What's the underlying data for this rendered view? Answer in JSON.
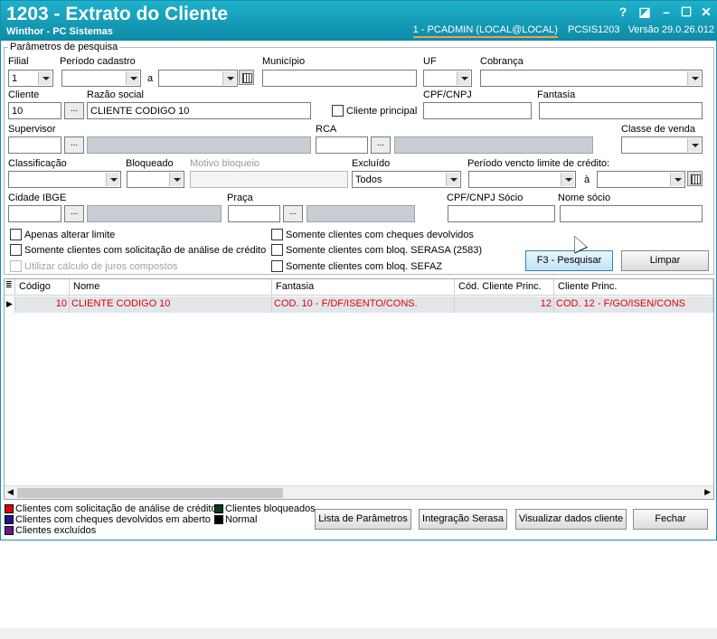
{
  "window": {
    "title": "1203 - Extrato do Cliente",
    "subtitle": "Winthor - PC Sistemas",
    "user": "1 - PCADMIN (LOCAL@LOCAL)",
    "routine": "PCSIS1203",
    "version": "Versão  29.0.26.012"
  },
  "params": {
    "legend": "Parâmetros de pesquisa",
    "filial_label": "Filial",
    "filial_value": "1",
    "periodo_cadastro_label": "Período cadastro",
    "a_label": "a",
    "municipio_label": "Município",
    "uf_label": "UF",
    "cobranca_label": "Cobrança",
    "cliente_label": "Cliente",
    "cliente_value": "10",
    "razao_social_label": "Razão social",
    "razao_social_value": "CLIENTE CODIGO 10",
    "cliente_principal_label": "Cliente principal",
    "cpf_cnpj_label": "CPF/CNPJ",
    "fantasia_label": "Fantasia",
    "supervisor_label": "Supervisor",
    "rca_label": "RCA",
    "classe_venda_label": "Classe de venda",
    "classificacao_label": "Classificação",
    "bloqueado_label": "Bloqueado",
    "motivo_bloqueio_label": "Motivo bloqueio",
    "excluido_label": "Excluído",
    "excluido_value": "Todos",
    "periodo_vencto_label": "Período vencto limite de crédito:",
    "a2_label": "à",
    "cidade_ibge_label": "Cidade IBGE",
    "praca_label": "Praça",
    "cpf_cnpj_socio_label": "CPF/CNPJ Sócio",
    "nome_socio_label": "Nome sócio",
    "dots": "...",
    "opt_apenas_limite": "Apenas alterar limite",
    "opt_solicitacao": "Somente clientes com solicitação de análise de crédito",
    "opt_juros": "Utilizar cálculo de juros compostos",
    "opt_cheques": "Somente clientes com cheques devolvidos",
    "opt_serasa": "Somente clientes com bloq. SERASA (2583)",
    "opt_sefaz": "Somente clientes com bloq. SEFAZ",
    "btn_pesquisar": "F3 - Pesquisar",
    "btn_limpar": "Limpar"
  },
  "grid": {
    "columns": [
      "Código",
      "Nome",
      "Fantasia",
      "Cód. Cliente Princ.",
      "Cliente Princ."
    ],
    "rows": [
      {
        "codigo": "10",
        "nome": "CLIENTE CODIGO 10",
        "fantasia": "COD. 10 - F/DF/ISENTO/CONS.",
        "cod_princ": "12",
        "cliente_princ": "COD. 12 - F/GO/ISEN/CONS"
      }
    ]
  },
  "legend": {
    "solicitacao": "Clientes com solicitação de análise de crédito",
    "cheques": "Clientes com cheques devolvidos em aberto",
    "excluidos": "Clientes excluídos",
    "bloqueados": "Clientes bloqueados",
    "normal": "Normal",
    "colors": {
      "solicitacao": "#e00000",
      "cheques": "#1a1a8a",
      "excluidos": "#6a1a8a",
      "bloqueados": "#0a3a1a",
      "normal": "#000000"
    }
  },
  "footer_buttons": {
    "lista": "Lista de Parâmetros",
    "serasa": "Integração Serasa",
    "visualizar": "Visualizar dados cliente",
    "fechar": "Fechar"
  }
}
